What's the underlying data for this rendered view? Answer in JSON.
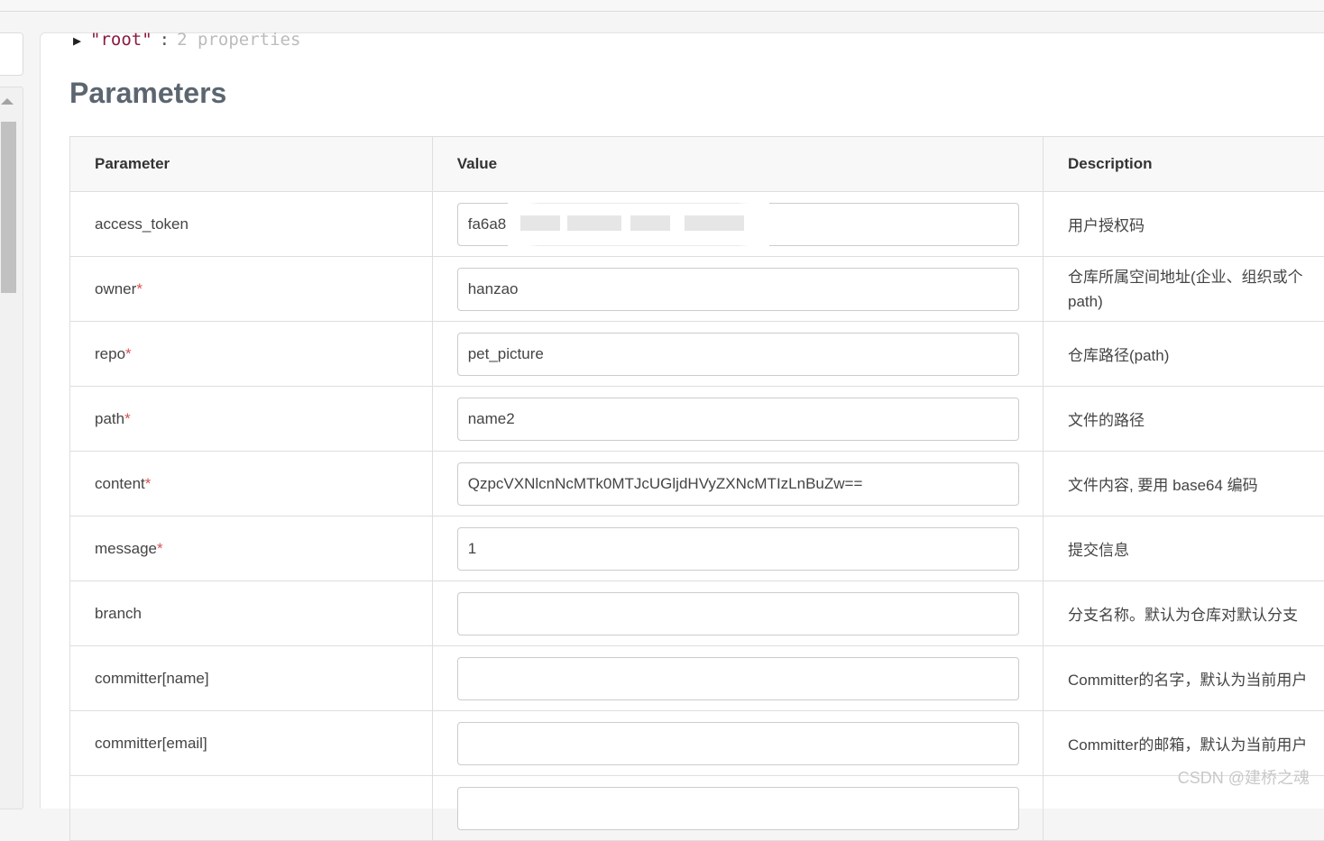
{
  "json_preview": {
    "key": "\"root\"",
    "separator": ":",
    "count": "2 properties"
  },
  "section_title": "Parameters",
  "table": {
    "headers": [
      "Parameter",
      "Value",
      "Description"
    ],
    "rows": [
      {
        "name": "access_token",
        "required": false,
        "value": "fa6a8",
        "description": "用户授权码"
      },
      {
        "name": "owner",
        "required": true,
        "value": "hanzao",
        "description": "仓库所属空间地址(企业、组织或个",
        "description_line2": "path)"
      },
      {
        "name": "repo",
        "required": true,
        "value": "pet_picture",
        "description": "仓库路径(path)"
      },
      {
        "name": "path",
        "required": true,
        "value": "name2",
        "description": "文件的路径"
      },
      {
        "name": "content",
        "required": true,
        "value": "QzpcVXNlcnNcMTk0MTJcUGljdHVyZXNcMTIzLnBuZw==",
        "description": "文件内容, 要用 base64 编码"
      },
      {
        "name": "message",
        "required": true,
        "value": "1",
        "description": "提交信息"
      },
      {
        "name": "branch",
        "required": false,
        "value": "",
        "description": "分支名称。默认为仓库对默认分支"
      },
      {
        "name": "committer[name]",
        "required": false,
        "value": "",
        "description": "Committer的名字，默认为当前用户"
      },
      {
        "name": "committer[email]",
        "required": false,
        "value": "",
        "description": "Committer的邮箱，默认为当前用户"
      }
    ]
  },
  "required_marker": "*",
  "watermark": "CSDN @建桥之魂"
}
